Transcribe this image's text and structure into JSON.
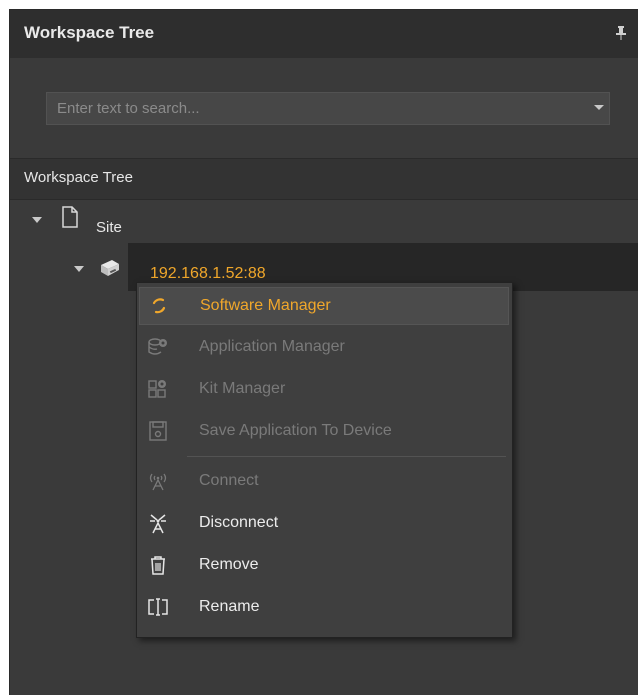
{
  "panel": {
    "title": "Workspace Tree",
    "pin_icon": "pin-icon"
  },
  "search": {
    "placeholder": "Enter text to search...",
    "value": ""
  },
  "section": {
    "label": "Workspace Tree"
  },
  "tree": {
    "site": {
      "label": "Site",
      "icon": "document-icon",
      "expanded": true
    },
    "device": {
      "label": "192.168.1.52:88",
      "icon": "device-icon",
      "expanded": true
    }
  },
  "context_menu": {
    "items": [
      {
        "label": "Software Manager",
        "icon": "spinner-icon",
        "state": "highlighted"
      },
      {
        "label": "Application Manager",
        "icon": "database-gear-icon",
        "state": "disabled"
      },
      {
        "label": "Kit Manager",
        "icon": "modules-gear-icon",
        "state": "disabled"
      },
      {
        "label": "Save Application To Device",
        "icon": "save-icon",
        "state": "disabled"
      },
      {
        "label": "Connect",
        "icon": "antenna-icon",
        "state": "disabled"
      },
      {
        "label": "Disconnect",
        "icon": "antenna-off-icon",
        "state": "enabled"
      },
      {
        "label": "Remove",
        "icon": "trash-icon",
        "state": "enabled"
      },
      {
        "label": "Rename",
        "icon": "rename-icon",
        "state": "enabled"
      }
    ]
  },
  "colors": {
    "accent": "#f0a72b",
    "panel_bg": "#3a3a3a",
    "menu_bg": "#3f3f3f"
  }
}
